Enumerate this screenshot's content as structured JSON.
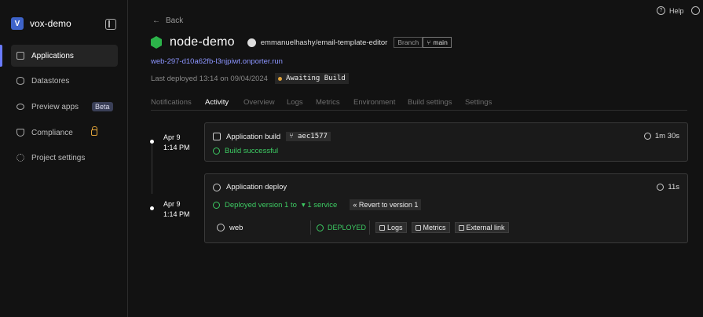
{
  "project": {
    "name": "vox-demo",
    "logo_letter": "V"
  },
  "sidebar": {
    "items": [
      {
        "label": "Applications",
        "icon": "applications-icon"
      },
      {
        "label": "Datastores",
        "icon": "database-icon"
      },
      {
        "label": "Preview apps",
        "icon": "eye-icon",
        "badge": "Beta"
      },
      {
        "label": "Compliance",
        "icon": "shield-icon",
        "locked": true
      },
      {
        "label": "Project settings",
        "icon": "gear-icon"
      }
    ]
  },
  "topbar": {
    "help_label": "Help"
  },
  "header": {
    "back_label": "Back",
    "app_name": "node-demo",
    "repo": "emmanuelhashy/email-template-editor",
    "branch_label": "Branch",
    "branch_name": "main",
    "url": "web-297-d10a62fb-l3njpiwt.onporter.run",
    "last_deployed": "Last deployed 13:14 on 09/04/2024",
    "status": "Awaiting Build"
  },
  "tabs": [
    "Notifications",
    "Activity",
    "Overview",
    "Logs",
    "Metrics",
    "Environment",
    "Build settings",
    "Settings"
  ],
  "active_tab": "Activity",
  "events": [
    {
      "date": "Apr 9",
      "time": "1:14 PM",
      "title": "Application build",
      "sha": "aec1577",
      "duration": "1m 30s",
      "status": "Build successful"
    },
    {
      "date": "Apr 9",
      "time": "1:14 PM",
      "title": "Application deploy",
      "duration": "11s",
      "status_prefix": "Deployed version 1 to",
      "services_label": "1 service",
      "revert_label": "Revert to version 1",
      "service": {
        "name": "web",
        "status": "DEPLOYED",
        "actions": [
          "Logs",
          "Metrics",
          "External link"
        ]
      }
    }
  ],
  "colors": {
    "accent": "#6a7bff",
    "success": "#3dcb63",
    "warning": "#e0a33a",
    "app_icon": "#2cb34a"
  }
}
